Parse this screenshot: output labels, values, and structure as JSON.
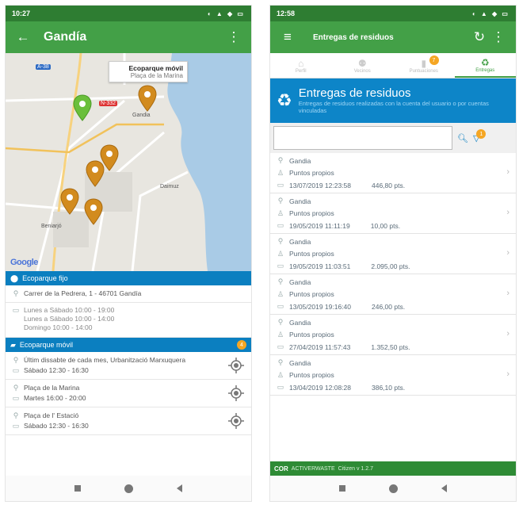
{
  "left": {
    "status": {
      "time": "10:27",
      "icons": "◐ ▲ ◆ ▭"
    },
    "appbar": {
      "title": "Gandía"
    },
    "map": {
      "callout_title": "Ecoparque móvil",
      "callout_sub": "Plaça de la Marina",
      "google": "Google",
      "labels": {
        "n332": "N-332",
        "a38": "A-38",
        "daimus": "Daimuz",
        "beniarjo": "Beniarjó",
        "gandia": "Gandia"
      }
    },
    "fijo": {
      "header": "Ecoparque fijo",
      "address": "Carrer de la Pedrera, 1 - 46701 Gandía",
      "hours": [
        "Lunes a Sábado 10:00 - 19:00",
        "Lunes a Sábado 10:00 - 14:00",
        "Domingo 10:00 - 14:00"
      ]
    },
    "movil": {
      "header": "Ecoparque móvil",
      "badge": "4",
      "items": [
        {
          "place": "Últim dissabte de cada mes, Urbanització Marxuquera",
          "time": "Sábado 12:30 - 16:30"
        },
        {
          "place": "Plaça de la Marina",
          "time": "Martes 16:00 - 20:00"
        },
        {
          "place": "Plaça de l' Estació",
          "time": "Sábado 12:30 - 16:30"
        }
      ]
    }
  },
  "right": {
    "status": {
      "time": "12:58",
      "icons": "◐ ▲ ◆ ▭"
    },
    "appbar": {
      "title": "Entregas de residuos"
    },
    "tabs": [
      {
        "label": "Perfil",
        "icon": "home-icon"
      },
      {
        "label": "Vecinos",
        "icon": "people-icon"
      },
      {
        "label": "Puntuaciones",
        "icon": "chart-icon",
        "badge": "7"
      },
      {
        "label": "Entregas",
        "icon": "recycle-icon"
      }
    ],
    "banner": {
      "title": "Entregas de residuos",
      "subtitle": "Entregas de residuos realizadas con la cuenta del usuario o por cuentas vinculadas"
    },
    "search": {
      "placeholder": "",
      "filter_badge": "1"
    },
    "entries": [
      {
        "place": "Gandia",
        "type": "Puntos propios",
        "date": "13/07/2019 12:23:58",
        "points": "446,80 pts."
      },
      {
        "place": "Gandia",
        "type": "Puntos propios",
        "date": "19/05/2019 11:11:19",
        "points": "10,00 pts."
      },
      {
        "place": "Gandia",
        "type": "Puntos propios",
        "date": "19/05/2019 11:03:51",
        "points": "2.095,00 pts."
      },
      {
        "place": "Gandia",
        "type": "Puntos propios",
        "date": "13/05/2019 19:16:40",
        "points": "246,00 pts."
      },
      {
        "place": "Gandia",
        "type": "Puntos propios",
        "date": "27/04/2019 11:57:43",
        "points": "1.352,50 pts."
      },
      {
        "place": "Gandia",
        "type": "Puntos propios",
        "date": "13/04/2019 12:08:28",
        "points": "386,10 pts."
      }
    ],
    "footer": {
      "brand": "COR",
      "app": "ACTIVERWASTE",
      "version": "Citizen v 1.2.7"
    }
  }
}
